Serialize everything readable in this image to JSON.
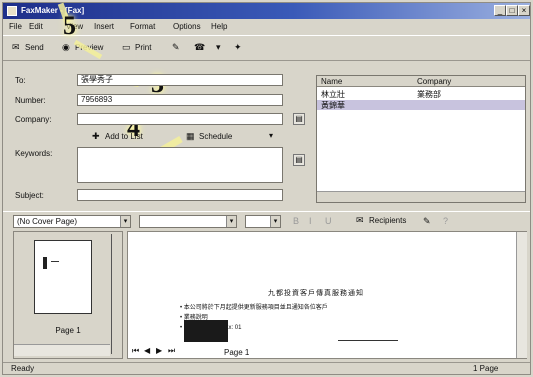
{
  "window": {
    "title": "FaxMaker - [Fax]",
    "min": "_",
    "max": "□",
    "close": "×"
  },
  "menu": [
    "File",
    "Edit",
    "View",
    "Insert",
    "Format",
    "Options",
    "Help"
  ],
  "toolbar": {
    "send": "Send",
    "preview": "Preview",
    "print": "Print"
  },
  "form": {
    "to_label": "To:",
    "to_value": "張學秀子",
    "number_label": "Number:",
    "number_value": "7956893",
    "company_label": "Company:",
    "company_value": "",
    "keywords_label": "Keywords:",
    "keywords_value": "",
    "subject_label": "Subject:",
    "subject_value": "",
    "add_to_list": "Add to List",
    "schedule": "Schedule"
  },
  "recipients": {
    "headers": [
      "Name",
      "Company"
    ],
    "rows": [
      {
        "name": "林立壯",
        "company": "業務部"
      },
      {
        "name": "黃錦華",
        "company": ""
      }
    ]
  },
  "cover": {
    "page_combo": "(No Cover Page)",
    "font_combo": "",
    "size_combo": "",
    "recipients_btn": "Recipients"
  },
  "pages_pane": {
    "thumb_label": "Page 1"
  },
  "preview_text": {
    "heading": "九都投資客戶傳真服務通知",
    "bullet1": "本公司將於下月起提供更新服務項目並且通知各位客戶",
    "bullet2": "業務說明",
    "bullet3": "如有疑問請洽 Fax: 01"
  },
  "nav": {
    "page_label": "Page 1"
  },
  "status": {
    "left": "Ready",
    "right": "1 Page"
  },
  "callouts": [
    "5",
    "3",
    "4"
  ]
}
